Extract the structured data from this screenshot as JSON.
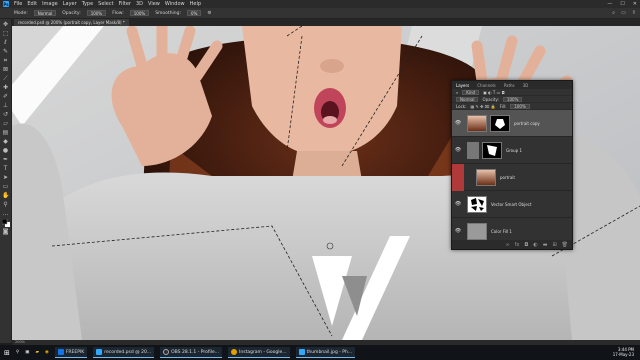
{
  "menu": [
    "File",
    "Edit",
    "Image",
    "Layer",
    "Type",
    "Select",
    "Filter",
    "3D",
    "View",
    "Window",
    "Help"
  ],
  "app_icon": "Ps",
  "window_controls": [
    "—",
    "☐",
    "✕"
  ],
  "options_bar": {
    "mode_label": "Mode:",
    "mode_value": "Normal",
    "opacity_label": "Opacity:",
    "opacity_value": "100%",
    "flow_label": "Flow:",
    "flow_value": "100%",
    "smoothing_label": "Smoothing:",
    "smoothing_value": "0%"
  },
  "document_tab": "recorded.psd @ 200% (portrait copy, Layer Mask/8) *",
  "status": "200%",
  "layers_panel": {
    "tabs": [
      "Layers",
      "Channels",
      "Paths",
      "3D"
    ],
    "kind_label": "Kind",
    "blend_mode": "Normal",
    "opacity_label": "Opacity:",
    "opacity_value": "100%",
    "lock_label": "Lock:",
    "fill_label": "Fill:",
    "fill_value": "100%",
    "layers": [
      {
        "name": "portrait copy",
        "selected": true
      },
      {
        "name": "Group 1",
        "selected": false
      },
      {
        "name": "portrait",
        "selected": false
      },
      {
        "name": "Vector Smart Object",
        "selected": false
      },
      {
        "name": "Color Fill 1",
        "selected": false
      }
    ],
    "bottom_icons": [
      "link-icon",
      "fx-icon",
      "mask-icon",
      "adjustment-icon",
      "folder-icon",
      "new-layer-icon",
      "trash-icon"
    ]
  },
  "taskbar": {
    "apps": [
      {
        "label": "FREEPIK",
        "color": "#1273eb"
      },
      {
        "label": "recorded.psd @ 20...",
        "color": "#31a8ff"
      },
      {
        "label": "OBS 28.1.1 - Profile...",
        "color": "#302e31"
      },
      {
        "label": "Instagram - Google...",
        "color": "#e0a100"
      },
      {
        "label": "thumbnail.jpg - Ph...",
        "color": "#31a8ff"
      }
    ],
    "time": "3:44 PM",
    "date": "17-May-23"
  },
  "colors": {
    "accent": "#31a8ff",
    "warning": "#b03a3a"
  }
}
